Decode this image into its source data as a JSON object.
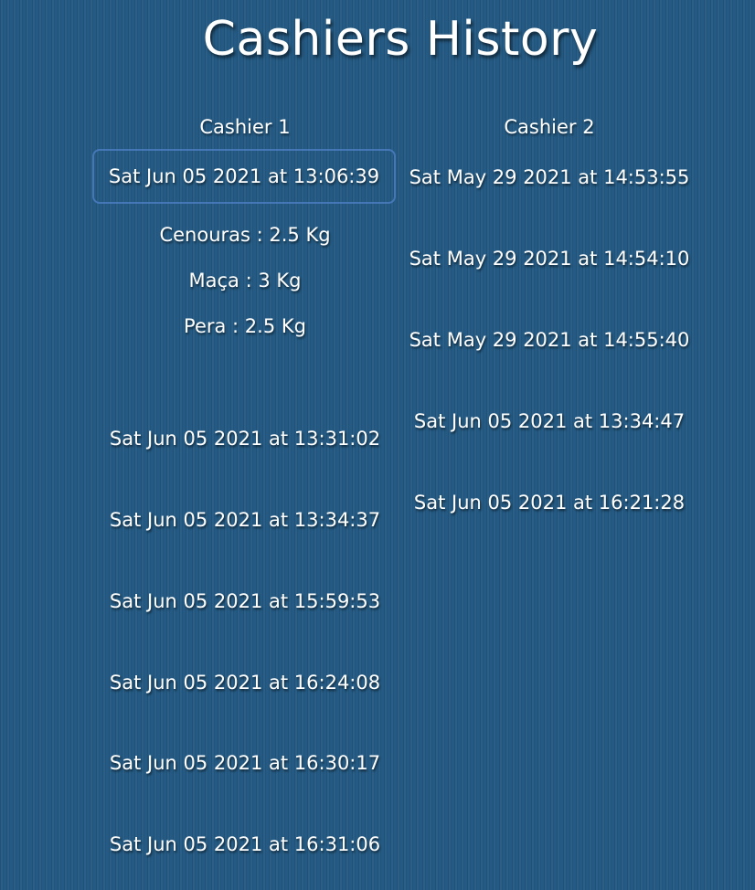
{
  "page": {
    "title": "Cashiers History"
  },
  "cashier1": {
    "label": "Cashier 1",
    "entries": [
      "Sat Jun 05 2021 at 13:06:39",
      "Sat Jun 05 2021 at 13:31:02",
      "Sat Jun 05 2021 at 13:34:37",
      "Sat Jun 05 2021 at 15:59:53",
      "Sat Jun 05 2021 at 16:24:08",
      "Sat Jun 05 2021 at 16:30:17",
      "Sat Jun 05 2021 at 16:31:06"
    ],
    "expanded_items": [
      "Cenouras : 2.5 Kg",
      "Maça : 3 Kg",
      "Pera : 2.5 Kg"
    ]
  },
  "cashier2": {
    "label": "Cashier 2",
    "entries": [
      "Sat May 29 2021 at 14:53:55",
      "Sat May 29 2021 at 14:54:10",
      "Sat May 29 2021 at 14:55:40",
      "Sat Jun 05 2021 at 13:34:47",
      "Sat Jun 05 2021 at 16:21:28"
    ]
  },
  "colors": {
    "background": "#245a83",
    "text": "#ffffff",
    "selected_border": "#5082c8"
  }
}
